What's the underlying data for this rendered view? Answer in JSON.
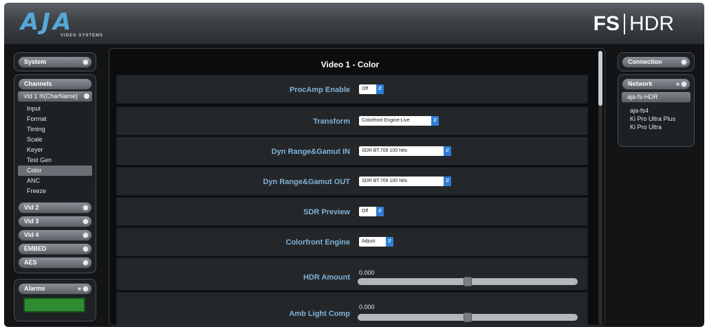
{
  "header": {
    "logo_mark": "AJA",
    "logo_sub": "VIDEO SYSTEMS",
    "product_fs": "FS",
    "product_hdr": "HDR"
  },
  "left": {
    "system_label": "System",
    "channels_label": "Channels",
    "vid1_label": "Vid 1 ®{CharName}",
    "nav_items": [
      "Input",
      "Format",
      "Timing",
      "Scale",
      "Keyer",
      "Test Gen",
      "Color",
      "ANC",
      "Freeze"
    ],
    "active_item": "Color",
    "vid2_label": "Vid 2",
    "vid3_label": "Vid 3",
    "vid4_label": "Vid 4",
    "embed_label": "EMBED",
    "aes_label": "AES",
    "alarms_label": "Alarms",
    "alarm_status_color": "#2f8b32"
  },
  "main": {
    "title": "Video 1 - Color",
    "procamp": {
      "label": "ProcAmp Enable",
      "value": "Off"
    },
    "transform": {
      "label": "Transform",
      "value": "Colorfront Engine-Live"
    },
    "dyn_in": {
      "label": "Dyn Range&Gamut IN",
      "value": "SDR BT.709 100 Nits"
    },
    "dyn_out": {
      "label": "Dyn Range&Gamut OUT",
      "value": "SDR BT.709 100 Nits"
    },
    "sdr_preview": {
      "label": "SDR Preview",
      "value": "Off"
    },
    "colorfront": {
      "label": "Colorfront Engine",
      "value": "Adjust"
    },
    "hdr_amount": {
      "label": "HDR Amount",
      "value": "0.000",
      "level": 0.5
    },
    "amb_light": {
      "label": "Amb Light Comp",
      "value": "0.000",
      "level": 0.5
    }
  },
  "right": {
    "connection_label": "Connection",
    "network_label": "Network",
    "network_selected": "aja-fs-HDR",
    "network_items": [
      "aja-fs4",
      "Ki Pro Ultra Plus",
      "Ki Pro Ultra"
    ]
  },
  "colors": {
    "accent_blue": "#55a8d8",
    "label_blue": "#7fb2d9",
    "select_arrow": "#2f7fd6"
  }
}
